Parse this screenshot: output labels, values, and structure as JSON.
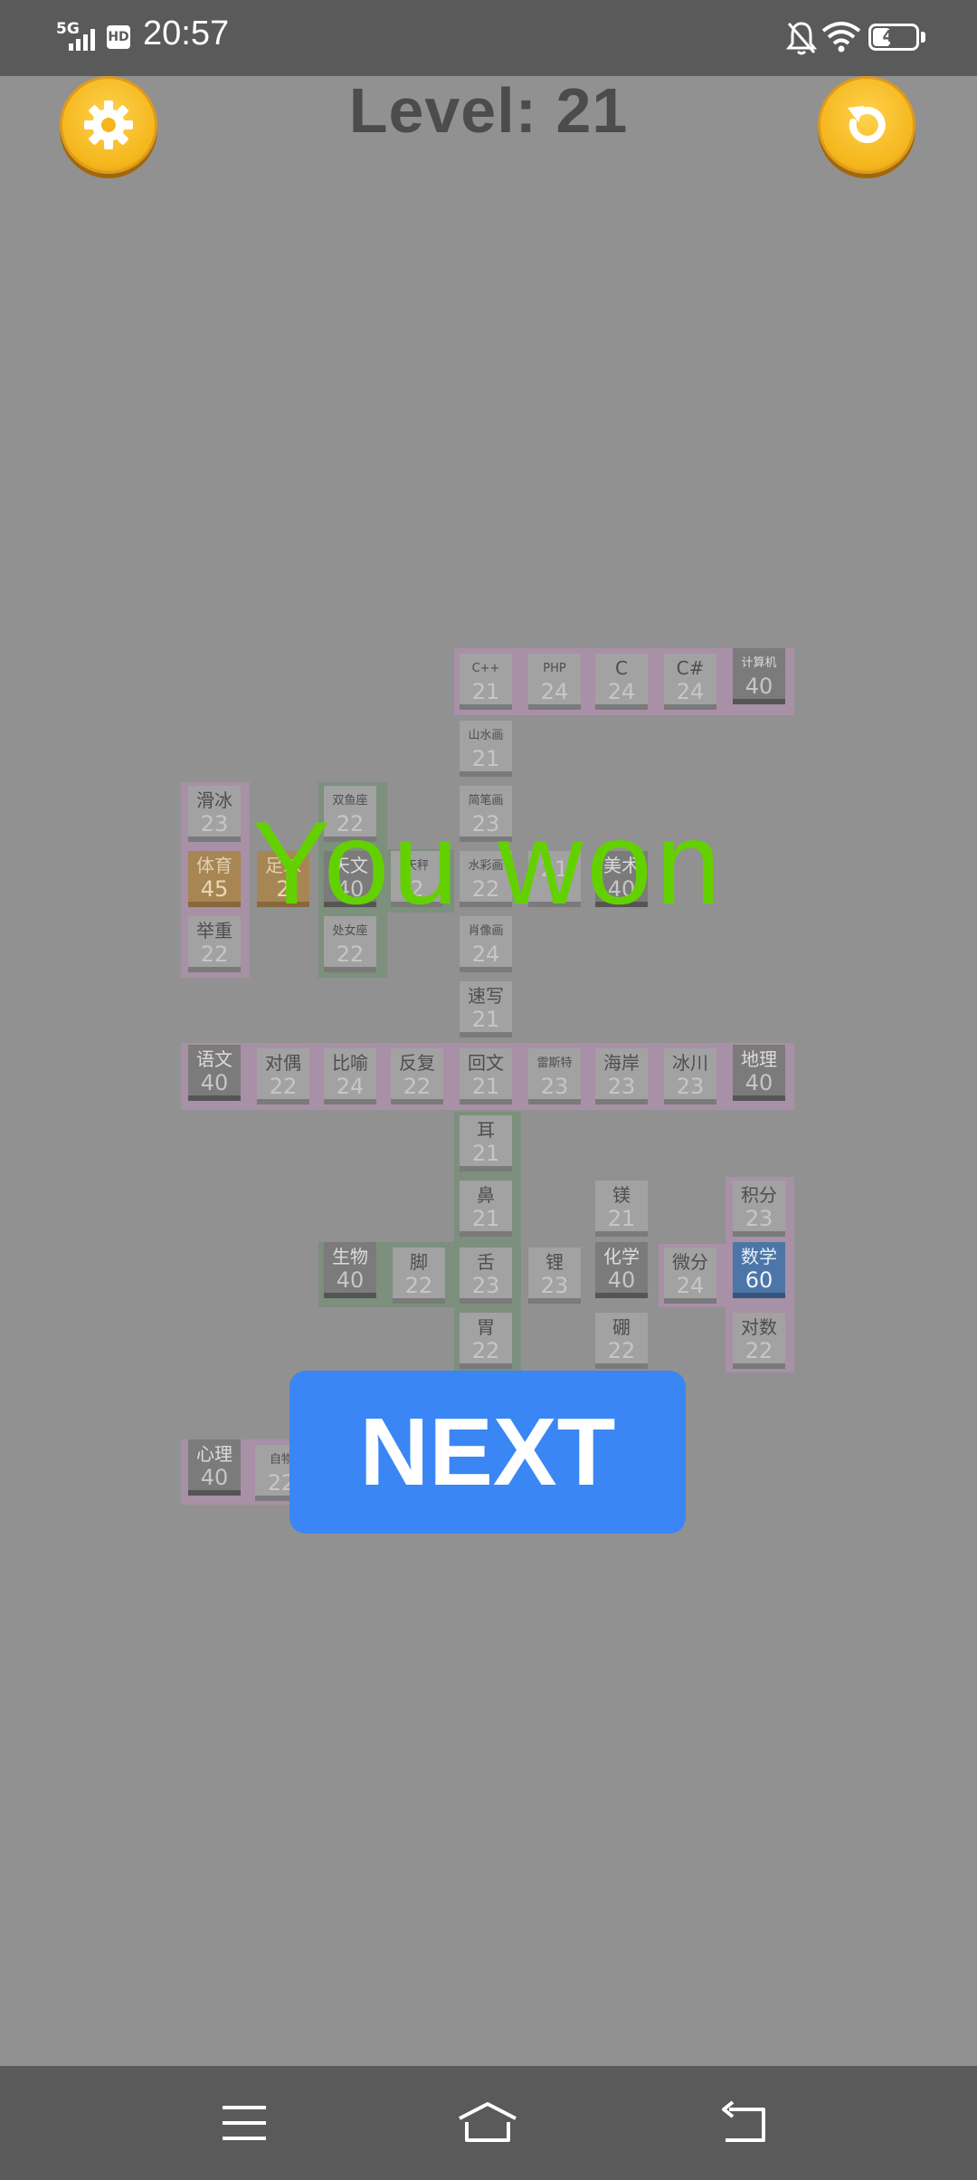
{
  "status_bar": {
    "network": "5G",
    "hd_label": "HD",
    "time": "20:57",
    "battery": "41",
    "battery_level": 0.41,
    "icons": [
      "signal-bars-icon",
      "hd-icon",
      "bell-off-icon",
      "wifi-icon",
      "battery-icon"
    ]
  },
  "header": {
    "level_title": "Level: 21",
    "settings_icon": "gear-icon",
    "restart_icon": "restart-icon"
  },
  "board": {
    "tiles": [
      {
        "word": "C++",
        "num": "21"
      },
      {
        "word": "PHP",
        "num": "24"
      },
      {
        "word": "C",
        "num": "24"
      },
      {
        "word": "C#",
        "num": "24"
      },
      {
        "word": "计算机",
        "num": "40"
      },
      {
        "word": "山水画",
        "num": "21"
      },
      {
        "word": "滑冰",
        "num": "23"
      },
      {
        "word": "双鱼座",
        "num": "22"
      },
      {
        "word": "简笔画",
        "num": "23"
      },
      {
        "word": "体育",
        "num": "45"
      },
      {
        "word": "足球",
        "num": "2"
      },
      {
        "word": "天文",
        "num": "40"
      },
      {
        "word": "天秤",
        "num": "2"
      },
      {
        "word": "水彩画",
        "num": "22"
      },
      {
        "word": "",
        "num": "21"
      },
      {
        "word": "美术",
        "num": "40"
      },
      {
        "word": "举重",
        "num": "22"
      },
      {
        "word": "处女座",
        "num": "22"
      },
      {
        "word": "肖像画",
        "num": "24"
      },
      {
        "word": "速写",
        "num": "21"
      },
      {
        "word": "语文",
        "num": "40"
      },
      {
        "word": "对偶",
        "num": "22"
      },
      {
        "word": "比喻",
        "num": "24"
      },
      {
        "word": "反复",
        "num": "22"
      },
      {
        "word": "回文",
        "num": "21"
      },
      {
        "word": "雷斯特",
        "num": "23"
      },
      {
        "word": "海岸",
        "num": "23"
      },
      {
        "word": "冰川",
        "num": "23"
      },
      {
        "word": "地理",
        "num": "40"
      },
      {
        "word": "耳",
        "num": "21"
      },
      {
        "word": "鼻",
        "num": "21"
      },
      {
        "word": "镁",
        "num": "21"
      },
      {
        "word": "积分",
        "num": "23"
      },
      {
        "word": "生物",
        "num": "40"
      },
      {
        "word": "脚",
        "num": "22"
      },
      {
        "word": "舌",
        "num": "23"
      },
      {
        "word": "锂",
        "num": "23"
      },
      {
        "word": "化学",
        "num": "40"
      },
      {
        "word": "微分",
        "num": "24"
      },
      {
        "word": "数学",
        "num": "60"
      },
      {
        "word": "胃",
        "num": "22"
      },
      {
        "word": "硼",
        "num": "22"
      },
      {
        "word": "对数",
        "num": "22"
      },
      {
        "word": "心理",
        "num": "40"
      },
      {
        "word": "自物",
        "num": "22"
      }
    ]
  },
  "overlay": {
    "win_message": "You won",
    "next_label": "NEXT"
  },
  "nav_bar": {
    "icons": [
      "menu-icon",
      "home-icon",
      "back-icon"
    ]
  },
  "colors": {
    "background": "#919191",
    "win_text": "#63d100",
    "next_button": "#3b86f5",
    "coin_button": "#f4b61c",
    "highlight_blue": "#4d76a8",
    "highlight_orange": "#a88653"
  }
}
